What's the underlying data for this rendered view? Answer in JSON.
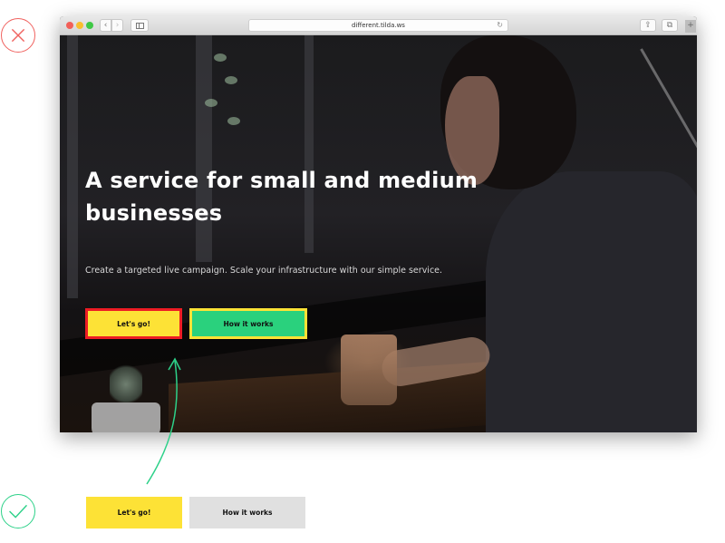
{
  "annotations": {
    "bad_mark": "x-mark",
    "good_mark": "check-mark",
    "colors": {
      "bad": "#f0625f",
      "good": "#2dd189",
      "arrow": "#2dd189"
    }
  },
  "browser": {
    "url": "different.tilda.ws",
    "icons": {
      "back": "‹",
      "forward": "›",
      "reload": "↻",
      "share": "⇪",
      "tabs": "⧉",
      "new_tab": "+"
    }
  },
  "hero": {
    "headline": "A service for small and medium businesses",
    "subtitle": "Create a targeted live campaign. Scale your infrastructure with our simple service.",
    "buttons": [
      {
        "label": "Let's go!",
        "bg": "#fde236",
        "border": "#ed1c24"
      },
      {
        "label": "How it works",
        "bg": "#2ad17d",
        "border": "#fde236"
      }
    ]
  },
  "good_example": {
    "buttons": [
      {
        "label": "Let's go!",
        "bg": "#fde236"
      },
      {
        "label": "How it works",
        "bg": "#e0e0e0"
      }
    ]
  }
}
